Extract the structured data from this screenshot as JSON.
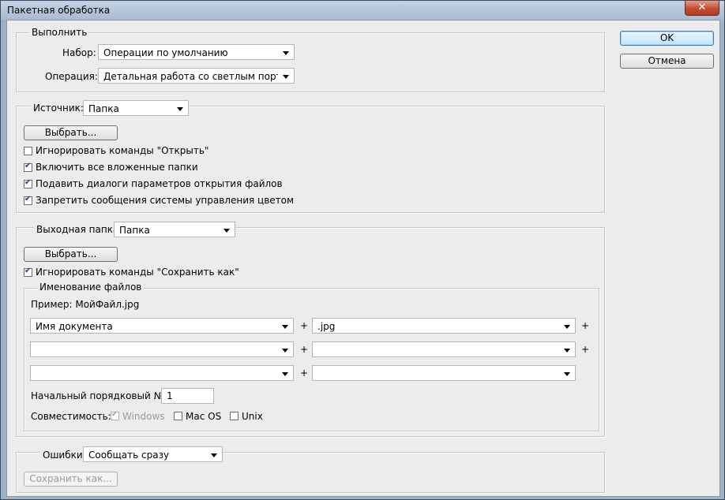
{
  "window": {
    "title": "Пакетная обработка",
    "close_glyph": "✕"
  },
  "buttons": {
    "ok": "OK",
    "cancel": "Отмена"
  },
  "run": {
    "legend": "Выполнить",
    "set_label": "Набор:",
    "set_value": "Операции по умолчанию",
    "action_label": "Операция:",
    "action_value": "Детальная работа со светлым портр..."
  },
  "source": {
    "label": "Источник:",
    "value": "Папка",
    "choose_button": "Выбрать...",
    "checks": [
      {
        "label": "Игнорировать команды \"Открыть\"",
        "checked": false
      },
      {
        "label": "Включить все вложенные папки",
        "checked": true
      },
      {
        "label": "Подавить диалоги параметров открытия файлов",
        "checked": true
      },
      {
        "label": "Запретить сообщения системы управления цветом",
        "checked": true
      }
    ]
  },
  "destination": {
    "label": "Выходная папка:",
    "value": "Папка",
    "choose_button": "Выбрать...",
    "override_save_as": {
      "label": "Игнорировать команды \"Сохранить как\"",
      "checked": true
    },
    "naming": {
      "legend": "Именование файлов",
      "example": "Пример: МойФайл.jpg",
      "fields": [
        "Имя документа",
        ".jpg",
        "",
        "",
        "",
        ""
      ],
      "plus": "+",
      "start_serial_label": "Начальный порядковый №:",
      "start_serial_value": "1",
      "compat_label": "Совместимость:",
      "compat": [
        {
          "label": "Windows",
          "checked": true,
          "disabled": true
        },
        {
          "label": "Mac OS",
          "checked": false,
          "disabled": false
        },
        {
          "label": "Unix",
          "checked": false,
          "disabled": false
        }
      ]
    }
  },
  "errors": {
    "label": "Ошибки:",
    "value": "Сообщать сразу",
    "save_as_button": "Сохранить как..."
  }
}
